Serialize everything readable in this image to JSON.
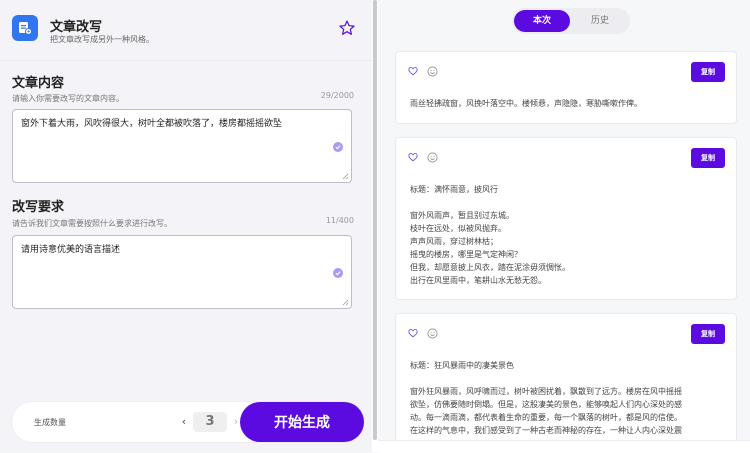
{
  "app": {
    "title": "文章改写",
    "subtitle": "把文章改写成另外一种风格。"
  },
  "content_section": {
    "title": "文章内容",
    "description": "请输入你需要改写的文章内容。",
    "counter": "29/2000",
    "value": "窗外下着大雨，风吹得很大，树叶全都被吹落了，楼房都摇摇欲坠"
  },
  "requirement_section": {
    "title": "改写要求",
    "description": "请告诉我们文章需要按照什么要求进行改写。",
    "counter": "11/400",
    "value": "请用诗意优美的语言描述"
  },
  "generate": {
    "label": "生成数量",
    "count": "3",
    "prev": "‹",
    "next": "›",
    "button": "开始生成"
  },
  "tabs": [
    "本次",
    "历史"
  ],
  "cards": [
    {
      "copy": "复制",
      "lines": [
        "雨丝轻拂疏窗，风挽叶落空中。楼倾悬，声隐隐，寒胁嘶嗽作俾。"
      ]
    },
    {
      "copy": "复制",
      "lines": [
        "标题：满怀雨意，披风行",
        "",
        "窗外风雨声，暂且别过东城。",
        "枝叶在远处，似被风抛弃。",
        "声声风雨，穿过树林枯；",
        "摇曳的楼房，哪里是气定神闲？",
        "但我，却愿意披上风衣，踏在泥涂毋须惆怅。",
        "出行在风里雨中，笔耕山水无愁无怨。"
      ]
    },
    {
      "copy": "复制",
      "lines": [
        "标题：狂风暴雨中的凄美景色",
        "",
        "窗外狂风暴雨，风呼啸而过，树叶被困扰着，飘散到了远方。楼房在风中摇摇",
        "欲坠，仿佛要随时倒塌。但是，这股凄美的景色，能够唤起人们内心深处的感",
        "动。每一滴雨滴，都代表着生命的重要，每一个飘落的树叶，都是风的信使。",
        "在这样的气息中，我们感受到了一种古老而神秘的存在，一种让人内心深处震"
      ]
    }
  ],
  "colors": {
    "accent": "#5b0ae0",
    "app_icon": "#2f76f0"
  }
}
